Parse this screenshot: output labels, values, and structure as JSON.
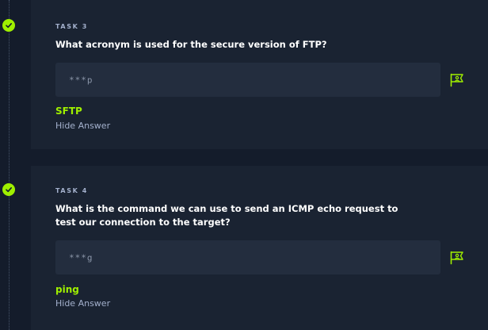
{
  "colors": {
    "background": "#141c2b",
    "card": "#1a2332",
    "input": "#232d3e",
    "accent": "#9fef00",
    "muted": "#a4b1cd"
  },
  "tasks": [
    {
      "label": "TASK 3",
      "question": "What acronym is used for the secure version of FTP?",
      "answer_mask": "***p",
      "answer": "SFTP",
      "hide_label": "Hide Answer",
      "completed_icon": "check-icon",
      "submit_icon": "flag-icon"
    },
    {
      "label": "TASK 4",
      "question": "What is the command we can use to send an ICMP echo request to test our connection to the target?",
      "answer_mask": "***g",
      "answer": "ping",
      "hide_label": "Hide Answer",
      "completed_icon": "check-icon",
      "submit_icon": "flag-icon"
    }
  ]
}
